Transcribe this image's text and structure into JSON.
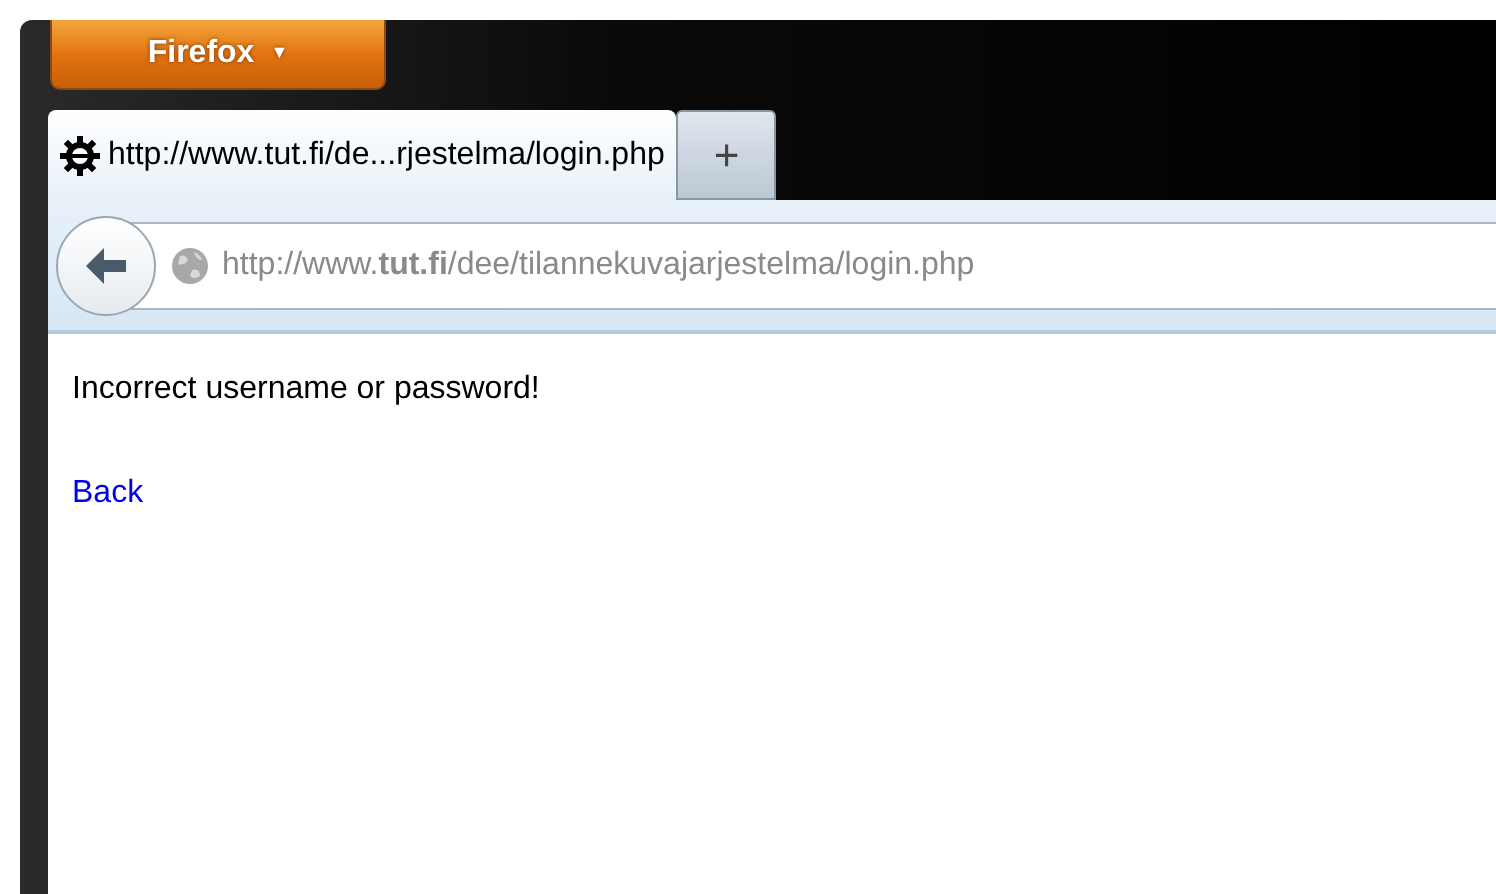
{
  "firefox_button": {
    "label": "Firefox",
    "caret": "▼"
  },
  "tabs": [
    {
      "title": "http://www.tut.fi/de...rjestelma/login.php",
      "selected": true
    }
  ],
  "new_tab_button": {
    "label": "+"
  },
  "address_bar": {
    "url": "http://www.**tut.fi**/dee/tilannekuvajarjestelma/login.php"
  },
  "page": {
    "message": "Incorrect username or password!",
    "link": "Back"
  }
}
